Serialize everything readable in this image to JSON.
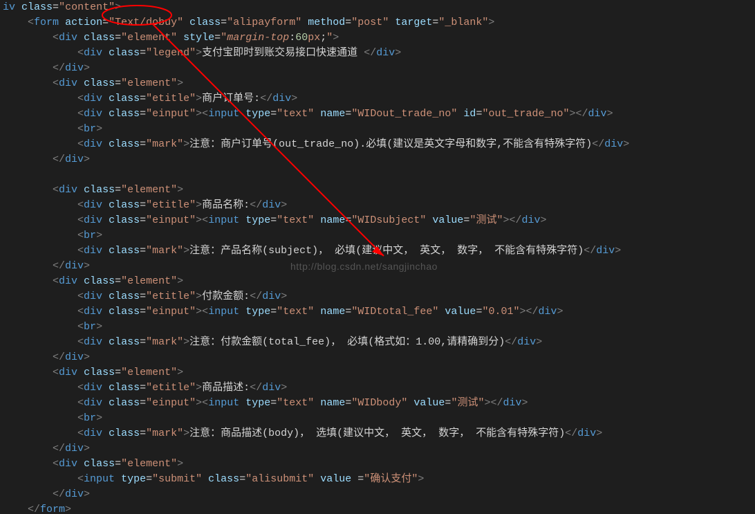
{
  "watermark": "http://blog.csdn.net/sangjinchao",
  "line0": {
    "tag": "iv",
    "class": "content"
  },
  "form": {
    "action": "Text/dobuy",
    "class": "alipayform",
    "method": "post",
    "target": "_blank"
  },
  "el1": {
    "class": "element",
    "style_prop": "margin-top",
    "style_num": "60",
    "style_unit": "px"
  },
  "legend": {
    "class": "legend",
    "text": "支付宝即时到账交易接口快速通道 "
  },
  "elClass": "element",
  "etitleClass": "etitle",
  "einputClass": "einput",
  "markClass": "mark",
  "block1": {
    "etitle": "商户订单号:",
    "input": {
      "type": "text",
      "name": "WIDout_trade_no",
      "id": "out_trade_no"
    },
    "mark": "注意：商户订单号(out_trade_no).必填(建议是英文字母和数字,不能含有特殊字符)"
  },
  "block2": {
    "etitle": "商品名称:",
    "input": {
      "type": "text",
      "name": "WIDsubject",
      "value": "测试"
    },
    "mark": "注意：产品名称(subject)， 必填(建议中文， 英文， 数字， 不能含有特殊字符)"
  },
  "block3": {
    "etitle": "付款金额:",
    "input": {
      "type": "text",
      "name": "WIDtotal_fee",
      "value": "0.01"
    },
    "mark": "注意：付款金额(total_fee)， 必填(格式如：1.00,请精确到分)"
  },
  "block4": {
    "etitle": "商品描述:",
    "input": {
      "type": "text",
      "name": "WIDbody",
      "value": "测试"
    },
    "mark": "注意：商品描述(body)， 选填(建议中文， 英文， 数字， 不能含有特殊字符)"
  },
  "submit": {
    "type": "submit",
    "class": "alisubmit",
    "value": "确认支付"
  }
}
